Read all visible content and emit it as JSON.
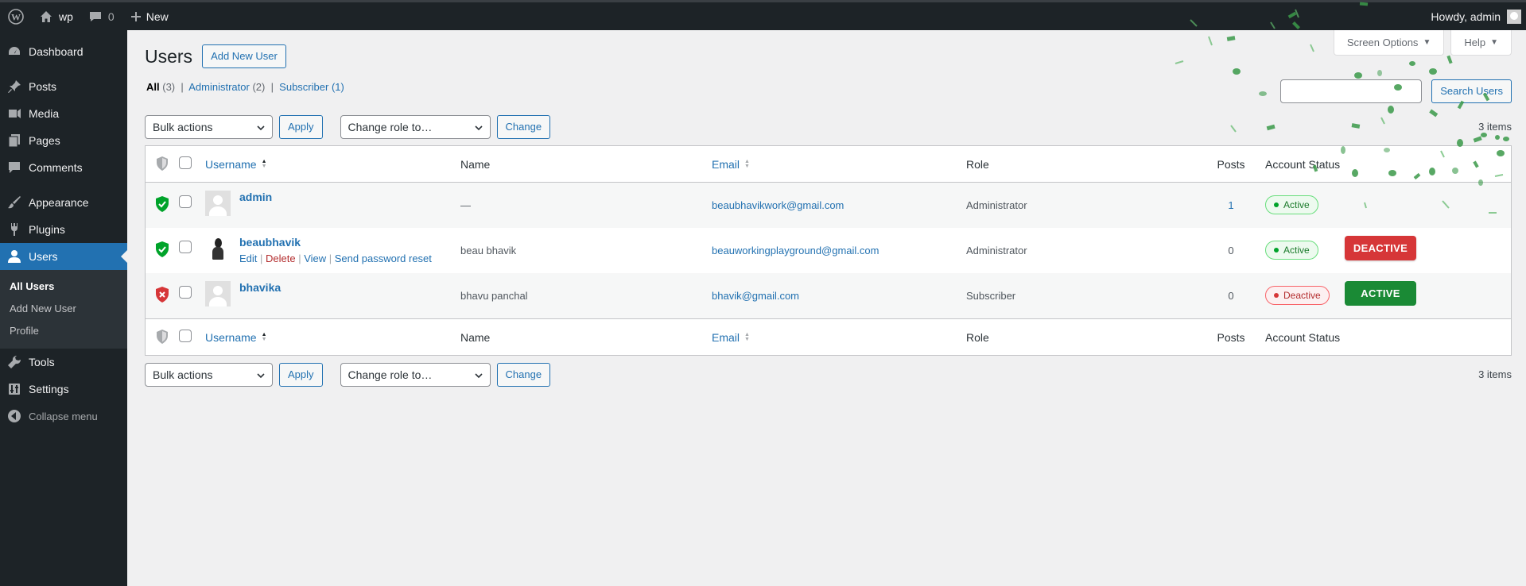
{
  "admin_bar": {
    "site_name": "wp",
    "comments_count": "0",
    "new_label": "New",
    "howdy": "Howdy, admin"
  },
  "sidebar": {
    "items": [
      {
        "label": "Dashboard",
        "icon": "dashboard-icon"
      },
      {
        "label": "Posts",
        "icon": "pin-icon"
      },
      {
        "label": "Media",
        "icon": "media-icon"
      },
      {
        "label": "Pages",
        "icon": "pages-icon"
      },
      {
        "label": "Comments",
        "icon": "comment-icon"
      },
      {
        "label": "Appearance",
        "icon": "brush-icon"
      },
      {
        "label": "Plugins",
        "icon": "plug-icon"
      },
      {
        "label": "Users",
        "icon": "user-icon"
      },
      {
        "label": "Tools",
        "icon": "wrench-icon"
      },
      {
        "label": "Settings",
        "icon": "settings-icon"
      }
    ],
    "submenu": [
      "All Users",
      "Add New User",
      "Profile"
    ],
    "collapse": "Collapse menu"
  },
  "page": {
    "title": "Users",
    "add_new": "Add New User",
    "screen_options": "Screen Options",
    "help": "Help",
    "search_button": "Search Users",
    "search_value": "",
    "filters": {
      "all": "All",
      "all_count": "(3)",
      "admin": "Administrator",
      "admin_count": "(2)",
      "subscriber": "Subscriber",
      "subscriber_count": "(1)"
    },
    "bulk_actions": "Bulk actions",
    "apply": "Apply",
    "change_role": "Change role to…",
    "change": "Change",
    "items_count": "3 items"
  },
  "table": {
    "headers": {
      "username": "Username",
      "name": "Name",
      "email": "Email",
      "role": "Role",
      "posts": "Posts",
      "status": "Account Status"
    },
    "rows": [
      {
        "username": "admin",
        "name": "—",
        "email": "beaubhavikwork@gmail.com",
        "role": "Administrator",
        "posts": "1",
        "status": "Active",
        "action": ""
      },
      {
        "username": "beaubhavik",
        "name": "beau bhavik",
        "email": "beauworkingplayground@gmail.com",
        "role": "Administrator",
        "posts": "0",
        "status": "Active",
        "action": "DEACTIVE",
        "row_actions": {
          "edit": "Edit",
          "delete": "Delete",
          "view": "View",
          "reset": "Send password reset"
        }
      },
      {
        "username": "bhavika",
        "name": "bhavu panchal",
        "email": "bhavik@gmail.com",
        "role": "Subscriber",
        "posts": "0",
        "status": "Deactive",
        "action": "ACTIVE"
      }
    ]
  },
  "colors": {
    "primary": "#2271b1",
    "admin_bar": "#1d2327",
    "active": "#00a32a",
    "danger": "#d63638",
    "confetti": "#3b9a4a"
  }
}
